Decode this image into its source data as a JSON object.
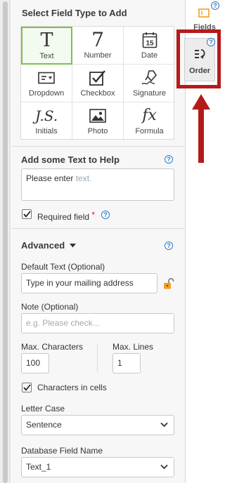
{
  "field_panel": {
    "title": "Select Field Type to Add",
    "types": [
      {
        "label": "Text",
        "icon": "text-T-icon",
        "selected": true
      },
      {
        "label": "Number",
        "icon": "number-7-icon",
        "selected": false
      },
      {
        "label": "Date",
        "icon": "calendar-15-icon",
        "selected": false
      },
      {
        "label": "Dropdown",
        "icon": "dropdown-icon",
        "selected": false
      },
      {
        "label": "Checkbox",
        "icon": "checkbox-icon",
        "selected": false
      },
      {
        "label": "Signature",
        "icon": "signature-pen-icon",
        "selected": false
      },
      {
        "label": "Initials",
        "icon": "initials-icon",
        "selected": false
      },
      {
        "label": "Photo",
        "icon": "photo-icon",
        "selected": false
      },
      {
        "label": "Formula",
        "icon": "formula-fx-icon",
        "selected": false
      }
    ],
    "icon_glyphs": {
      "text": "T",
      "number": "7",
      "date_day": "15",
      "initials": "J.S.",
      "formula": "fx"
    }
  },
  "help_text": {
    "title": "Add some Text to Help",
    "value_prefix": "Please enter ",
    "value_suffix": "text.",
    "required_label": "Required field",
    "required_mark": "*",
    "required_checked": true
  },
  "advanced": {
    "title": "Advanced",
    "default_text_label": "Default Text (Optional)",
    "default_text_value": "Type in your mailing address",
    "note_label": "Note (Optional)",
    "note_placeholder": "e.g. Please check...",
    "max_chars_label": "Max. Characters",
    "max_chars_value": "100",
    "max_lines_label": "Max. Lines",
    "max_lines_value": "1",
    "cells_label": "Characters in cells",
    "cells_checked": true,
    "letter_case_label": "Letter Case",
    "letter_case_value": "Sentence",
    "db_field_label": "Database Field Name",
    "db_field_value": "Text_1"
  },
  "side_tabs": {
    "fields_label": "Fields",
    "order_label": "Order"
  },
  "help_glyph": "?",
  "colors": {
    "accent_blue": "#2a78c8",
    "selected_green": "#7fbf4d",
    "highlight_red": "#b51a1a",
    "lock_orange": "#f0a020",
    "fields_orange": "#f0a020"
  }
}
